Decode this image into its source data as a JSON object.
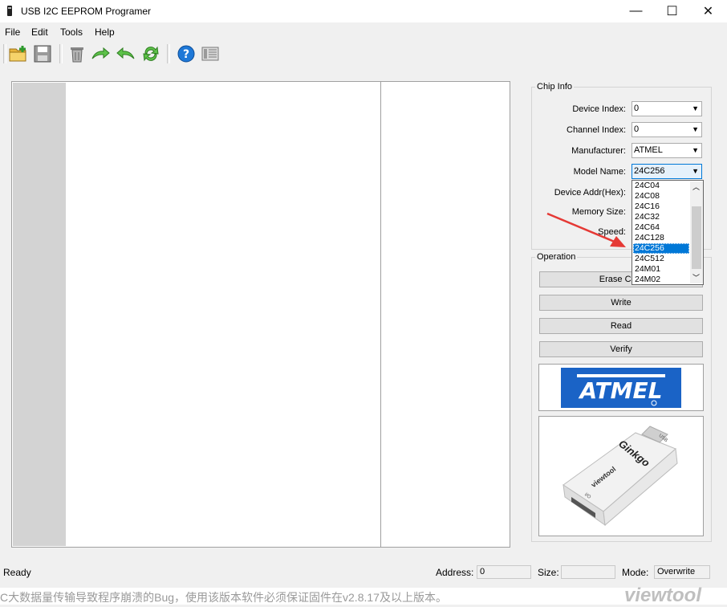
{
  "window": {
    "title": "USB I2C EEPROM Programer",
    "minimize": "—",
    "maximize": "☐",
    "close": "✕"
  },
  "menu": [
    "File",
    "Edit",
    "Tools",
    "Help"
  ],
  "chip_info": {
    "title": "Chip Info",
    "device_index": {
      "label": "Device Index:",
      "value": "0"
    },
    "channel_index": {
      "label": "Channel Index:",
      "value": "0"
    },
    "manufacturer": {
      "label": "Manufacturer:",
      "value": "ATMEL"
    },
    "model_name": {
      "label": "Model Name:",
      "value": "24C256"
    },
    "device_addr": {
      "label": "Device Addr(Hex):"
    },
    "memory_size": {
      "label": "Memory Size:"
    },
    "speed": {
      "label": "Speed:"
    },
    "model_options": [
      "24C04",
      "24C08",
      "24C16",
      "24C32",
      "24C64",
      "24C128",
      "24C256",
      "24C512",
      "24M01",
      "24M02"
    ],
    "model_selected_index": 6
  },
  "operation": {
    "title": "Operation",
    "erase": "Erase Chip",
    "write": "Write",
    "read": "Read",
    "verify": "Verify"
  },
  "logo": {
    "text": "ATMEL"
  },
  "device": {
    "name": "Ginkgo",
    "brand": "viewtool",
    "usb": "USB",
    "io": "I/O"
  },
  "status": {
    "text": "Ready",
    "address_label": "Address:",
    "address_value": "0",
    "size_label": "Size:",
    "size_value": "",
    "mode_label": "Mode:",
    "mode_value": "Overwrite"
  },
  "banner": {
    "text": "C大数据量传输导致程序崩溃的Bug，使用该版本软件必须保证固件在v2.8.17及以上版本。",
    "watermark": "viewtool"
  },
  "colors": {
    "accent": "#0078d7",
    "annotation_arrow": "#e53935",
    "atmel_blue": "#1a63c6"
  }
}
